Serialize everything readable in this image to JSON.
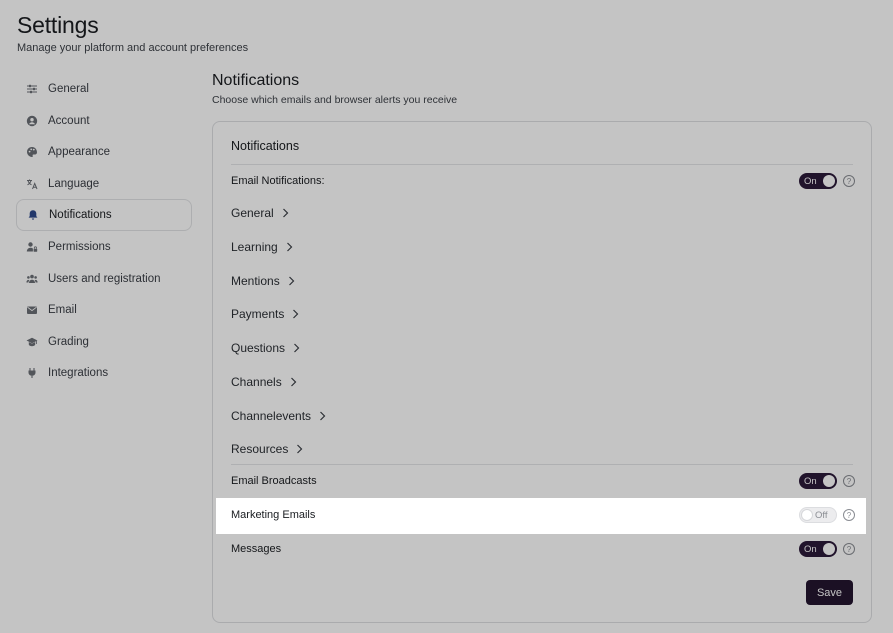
{
  "page": {
    "title": "Settings",
    "subtitle": "Manage your platform and account preferences"
  },
  "sidebar": {
    "items": [
      {
        "label": "General",
        "icon": "sliders-icon"
      },
      {
        "label": "Account",
        "icon": "user-circle-icon"
      },
      {
        "label": "Appearance",
        "icon": "palette-icon"
      },
      {
        "label": "Language",
        "icon": "translate-icon"
      },
      {
        "label": "Notifications",
        "icon": "bell-icon",
        "active": true
      },
      {
        "label": "Permissions",
        "icon": "user-lock-icon"
      },
      {
        "label": "Users and registration",
        "icon": "users-icon"
      },
      {
        "label": "Email",
        "icon": "envelope-icon"
      },
      {
        "label": "Grading",
        "icon": "graduation-cap-icon"
      },
      {
        "label": "Integrations",
        "icon": "plug-icon"
      }
    ]
  },
  "content": {
    "title": "Notifications",
    "subtitle": "Choose which emails and browser alerts you receive",
    "card_title": "Notifications",
    "email_notifications": {
      "label": "Email Notifications:",
      "toggle": "On"
    },
    "categories": [
      "General",
      "Learning",
      "Mentions",
      "Payments",
      "Questions",
      "Channels",
      "Channelevents",
      "Resources"
    ],
    "settings": [
      {
        "label": "Email Broadcasts",
        "toggle": "On"
      },
      {
        "label": "Marketing Emails",
        "toggle": "Off"
      },
      {
        "label": "Messages",
        "toggle": "On"
      }
    ],
    "help_glyph": "?",
    "save_label": "Save"
  },
  "colors": {
    "accent": "#2c1a3a",
    "save_button": "#241530",
    "overlay": "rgba(0,0,0,0.23)"
  }
}
